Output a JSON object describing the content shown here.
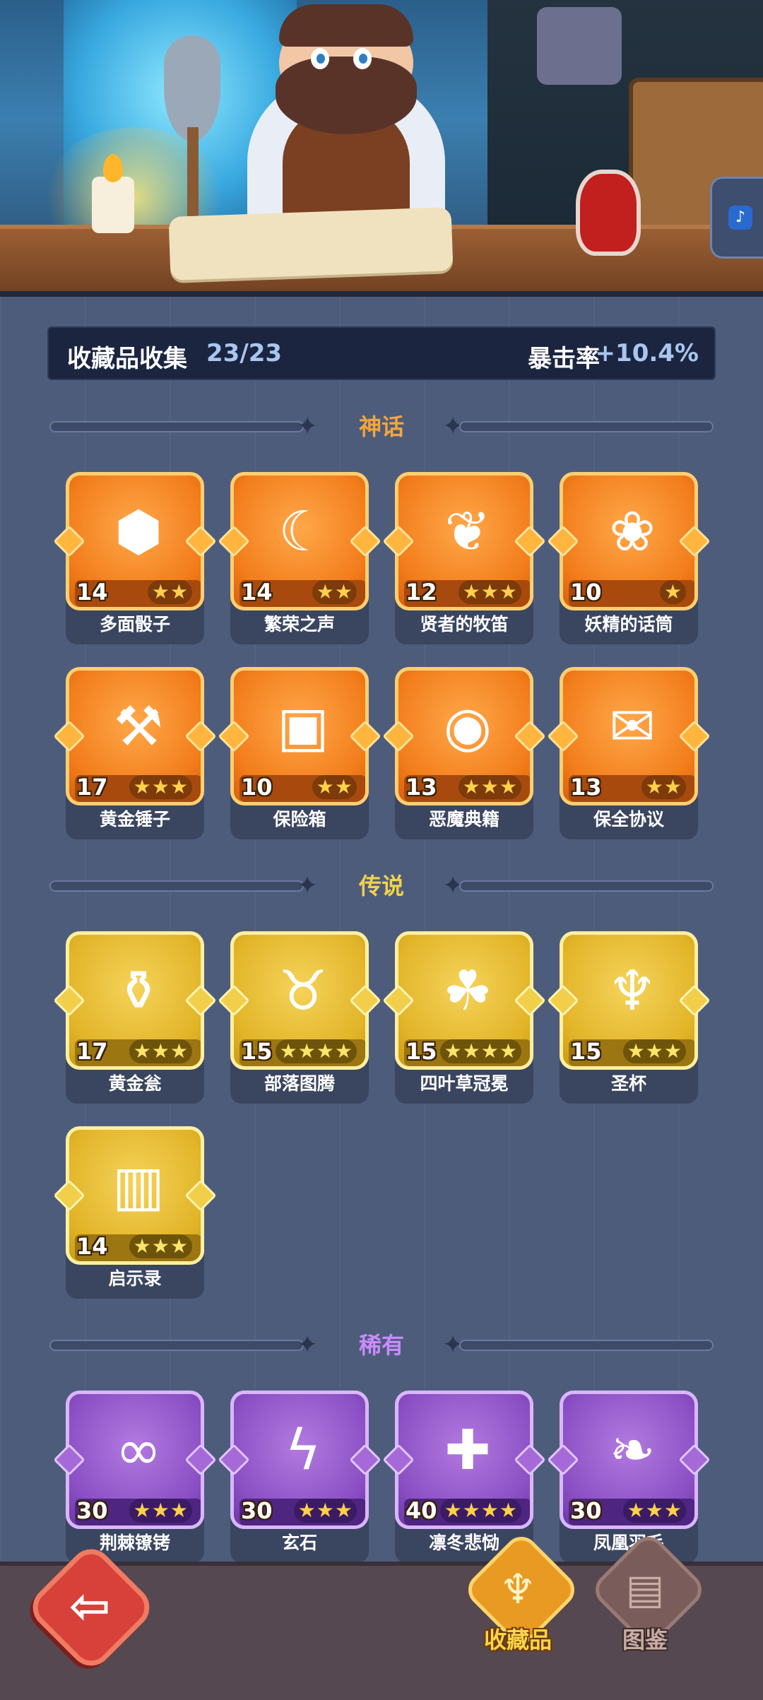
{
  "header": {
    "title": "收藏品收集",
    "count": "23/23",
    "crit_label": "暴击率",
    "crit_value": "+10.4%"
  },
  "sections": {
    "myth": {
      "label": "神话",
      "color": "#f4a63a"
    },
    "legend": {
      "label": "传说",
      "color": "#f2d24a"
    },
    "rare": {
      "label": "稀有",
      "color": "#c98bff"
    }
  },
  "myth_items": [
    {
      "name": "多面骰子",
      "level": "14",
      "stars": 2,
      "icon": "d20-dice-icon"
    },
    {
      "name": "繁荣之声",
      "level": "14",
      "stars": 2,
      "icon": "crescent-moon-icon"
    },
    {
      "name": "贤者的牧笛",
      "level": "12",
      "stars": 3,
      "icon": "flute-icon"
    },
    {
      "name": "妖精的话筒",
      "level": "10",
      "stars": 1,
      "icon": "fairy-microphone-icon"
    },
    {
      "name": "黄金锤子",
      "level": "17",
      "stars": 3,
      "icon": "golden-hammer-icon"
    },
    {
      "name": "保险箱",
      "level": "10",
      "stars": 2,
      "icon": "treasure-chest-icon"
    },
    {
      "name": "恶魔典籍",
      "level": "13",
      "stars": 3,
      "icon": "demon-book-icon"
    },
    {
      "name": "保全协议",
      "level": "13",
      "stars": 2,
      "icon": "contract-scroll-icon"
    }
  ],
  "legend_items": [
    {
      "name": "黄金瓮",
      "level": "17",
      "stars": 3,
      "icon": "golden-urn-icon"
    },
    {
      "name": "部落图腾",
      "level": "15",
      "stars": 4,
      "icon": "tribal-totem-icon"
    },
    {
      "name": "四叶草冠冕",
      "level": "15",
      "stars": 4,
      "icon": "clover-crown-icon"
    },
    {
      "name": "圣杯",
      "level": "15",
      "stars": 3,
      "icon": "chalice-icon"
    },
    {
      "name": "启示录",
      "level": "14",
      "stars": 3,
      "icon": "open-book-icon"
    }
  ],
  "rare_items": [
    {
      "name": "荆棘镣铐",
      "level": "30",
      "stars": 3,
      "icon": "thorn-shackles-icon"
    },
    {
      "name": "玄石",
      "level": "30",
      "stars": 3,
      "icon": "lightning-stone-icon"
    },
    {
      "name": "凛冬悲恸",
      "level": "40",
      "stars": 4,
      "icon": "frost-dagger-icon"
    },
    {
      "name": "凤凰羽毛",
      "level": "30",
      "stars": 3,
      "icon": "phoenix-feather-icon"
    }
  ],
  "nav": {
    "collection": "收藏品",
    "codex": "图鉴"
  }
}
